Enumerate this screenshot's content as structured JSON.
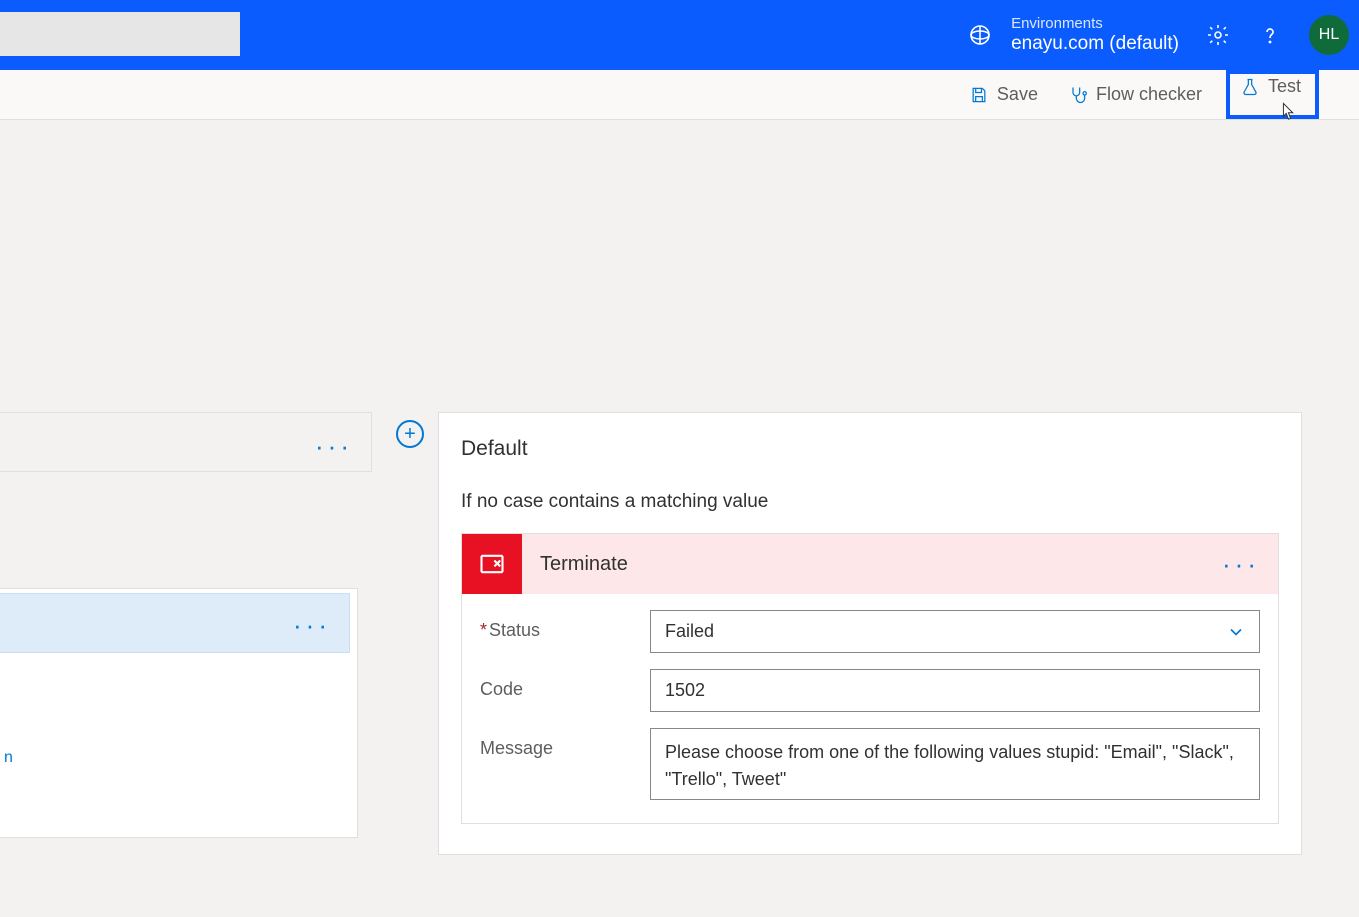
{
  "header": {
    "env_label": "Environments",
    "env_name": "enayu.com (default)",
    "avatar_initials": "HL"
  },
  "toolbar": {
    "save_label": "Save",
    "flow_checker_label": "Flow checker",
    "test_label": "Test"
  },
  "left": {
    "link_suffix": "n"
  },
  "plus_label": "+",
  "default_card": {
    "title": "Default",
    "subtitle": "If no case contains a matching value"
  },
  "terminate": {
    "title": "Terminate",
    "fields": {
      "status_label": "Status",
      "status_value": "Failed",
      "code_label": "Code",
      "code_value": "1502",
      "message_label": "Message",
      "message_value": "Please choose from one of the following values stupid: \"Email\", \"Slack\", \"Trello\", Tweet\""
    }
  }
}
